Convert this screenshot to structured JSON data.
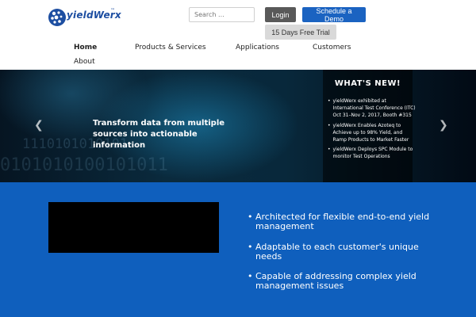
{
  "header": {
    "logo_text": "yieldWerx",
    "logo_tm": "™",
    "search_placeholder": "Search ...",
    "login_label": "Login",
    "demo_label": "Schedule a Demo",
    "trial_label": "15 Days Free Trial"
  },
  "nav": {
    "items": [
      {
        "label": "Home",
        "active": true
      },
      {
        "label": "Products & Services"
      },
      {
        "label": "Applications"
      },
      {
        "label": "Customers"
      },
      {
        "label": "About"
      }
    ]
  },
  "hero": {
    "caption": "Transform data from multiple sources into actionable information",
    "binary_line_1": "1110101010101",
    "binary_line_2": "0101010100101011",
    "left_arrow": "❮",
    "right_arrow": "❯"
  },
  "news": {
    "title": "WHAT'S NEW!",
    "items": [
      "yieldWerx exhibited at International Test Conference (ITC) Oct 31–Nov 2, 2017, Booth #315",
      "yieldWerx Enables Azoteq to Achieve up to 98% Yield, and Ramp Products to Market Faster",
      "yieldWerx Deploys SPC Module to monitor Test Operations"
    ]
  },
  "features": {
    "items": [
      "Architected for flexible end-to-end yield management",
      "Adaptable to each customer's unique needs",
      "Capable of addressing complex yield management issues"
    ]
  },
  "colors": {
    "brand_blue": "#1d4ea1",
    "section_blue": "#0f5fbd",
    "demo_button": "#1b63c1",
    "login_button": "#595959"
  }
}
